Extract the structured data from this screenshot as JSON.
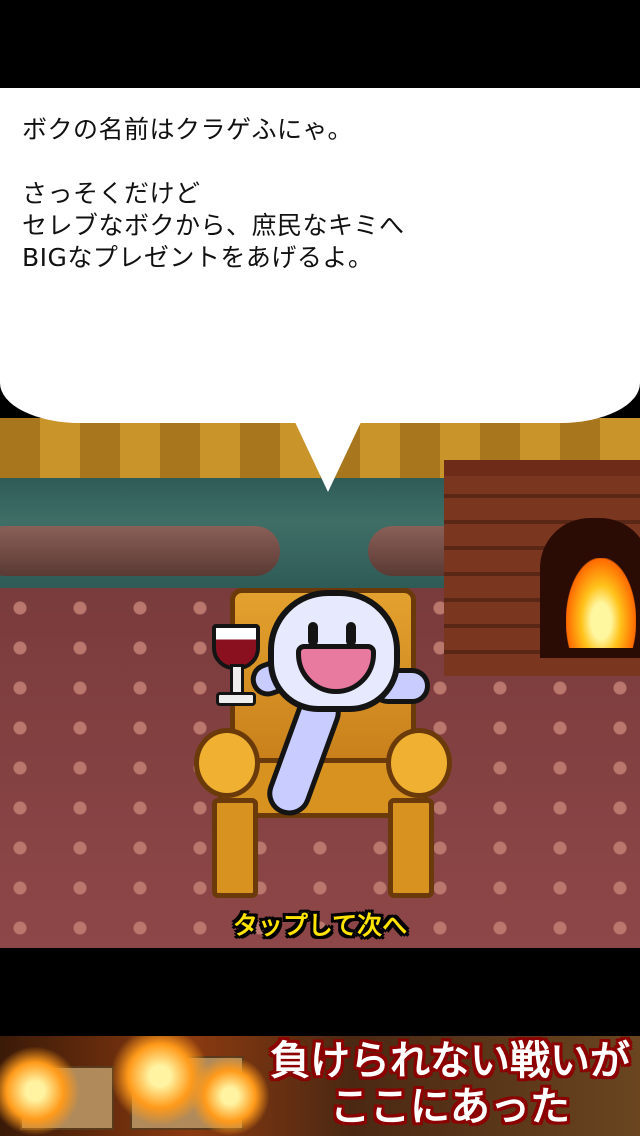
{
  "dialog": {
    "text": "ボクの名前はクラゲふにゃ。\n\nさっそくだけど\nセレブなボクから、庶民なキミへ\nBIGなプレゼントをあげるよ。"
  },
  "prompt": {
    "tap_next": "タップして次へ"
  },
  "ad_banner": {
    "text": "負けられない戦いが\nここにあった"
  },
  "colors": {
    "prompt_text": "#ffe400",
    "ad_text_outline": "#8b0000",
    "letterbox": "#000000"
  }
}
